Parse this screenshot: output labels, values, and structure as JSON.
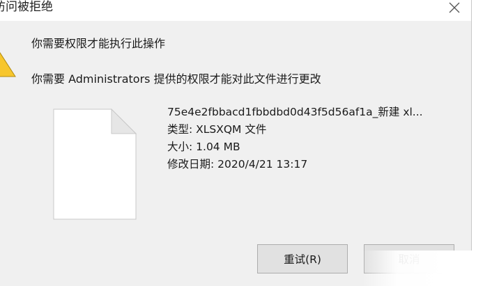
{
  "window": {
    "title": "访问被拒绝"
  },
  "dialog": {
    "heading": "你需要权限才能执行此操作",
    "message": "你需要 Administrators 提供的权限才能对此文件进行更改"
  },
  "file": {
    "name": "75e4e2fbbacd1fbbdbd0d43f5d56af1a_新建 xl...",
    "type_line": "类型: XLSXQM 文件",
    "size_line": "大小: 1.04 MB",
    "modified_line": "修改日期: 2020/4/21 13:17"
  },
  "buttons": {
    "retry": "重试(R)",
    "cancel": "取消"
  },
  "icons": {
    "close": "close-icon",
    "warning": "warning-icon",
    "file": "file-icon"
  },
  "colors": {
    "dialog_bg": "#f0f0f0",
    "titlebar_bg": "#ffffff",
    "warning_fill": "#f7c62d",
    "button_bg": "#e1e1e1",
    "button_border": "#adadad"
  }
}
